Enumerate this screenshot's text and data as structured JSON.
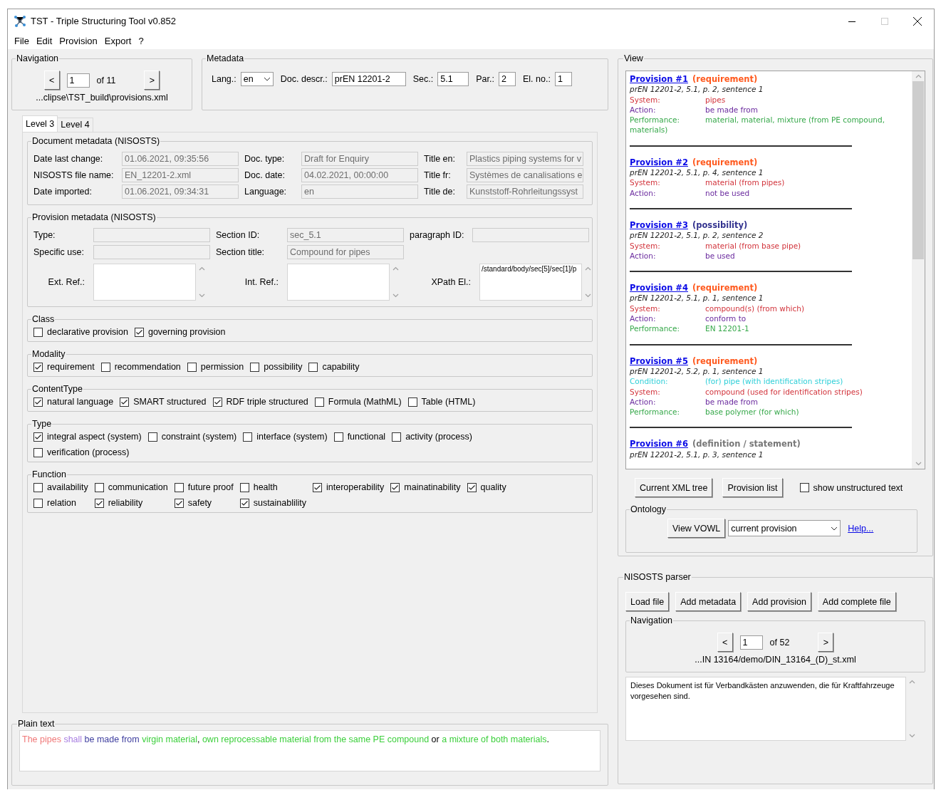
{
  "window": {
    "title": "TST - Triple Structuring Tool v0.852"
  },
  "menu": [
    "File",
    "Edit",
    "Provision",
    "Export",
    "?"
  ],
  "navigation": {
    "title": "Navigation",
    "prev": "<",
    "page": "1",
    "of": "of 11",
    "next": ">",
    "path": "...clipse\\TST_build\\provisions.xml"
  },
  "metadata": {
    "title": "Metadata",
    "fields": [
      {
        "label": "Lang.:",
        "value": "en",
        "kind": "select"
      },
      {
        "label": "Doc. descr.:",
        "value": "prEN 12201-2",
        "kind": "text"
      },
      {
        "label": "Sec.:",
        "value": "5.1",
        "kind": "text"
      },
      {
        "label": "Par.:",
        "value": "2",
        "kind": "short"
      },
      {
        "label": "El. no.:",
        "value": "1",
        "kind": "short"
      }
    ]
  },
  "tabs": [
    {
      "label": "Level 3",
      "selected": true
    },
    {
      "label": "Level 4",
      "selected": false
    }
  ],
  "document_metadata": {
    "title": "Document metadata (NISOSTS)",
    "fields": [
      {
        "label": "Date last change:",
        "value": "01.06.2021, 09:35:56"
      },
      {
        "label": "Doc. type:",
        "value": "Draft for Enquiry"
      },
      {
        "label": "Title en:",
        "value": "Plastics piping systems for v"
      },
      {
        "label": "NISOSTS file name:",
        "value": "EN_12201-2.xml"
      },
      {
        "label": "Doc. date:",
        "value": "04.02.2021, 00:00:00"
      },
      {
        "label": "Title fr:",
        "value": "Systèmes de canalisations e"
      },
      {
        "label": "Date imported:",
        "value": "01.06.2021, 09:34:31"
      },
      {
        "label": "Language:",
        "value": "en"
      },
      {
        "label": "Title de:",
        "value": "Kunststoff-Rohrleitungssyst"
      }
    ]
  },
  "provision_metadata": {
    "title": "Provision metadata (NISOSTS)",
    "fields": [
      {
        "label": "Type:"
      },
      {
        "label": "Section ID:",
        "value": "sec_5.1"
      },
      {
        "label": "paragraph ID:"
      },
      {
        "label": "Specific use:"
      },
      {
        "label": "Section title:",
        "value": "Compound for pipes"
      }
    ],
    "text_areas": [
      {
        "label": "Ext. Ref.:"
      },
      {
        "label": "Int. Ref.:"
      },
      {
        "label": "XPath El.:",
        "value": "/standard/body/sec[5]/sec[1]/p"
      }
    ]
  },
  "checkbox_groups": [
    {
      "title": "Class",
      "rows": [
        [
          {
            "label": "declarative provision",
            "checked": false
          },
          {
            "label": "governing provision",
            "checked": true
          }
        ]
      ]
    },
    {
      "title": "Modality",
      "rows": [
        [
          {
            "label": "requirement",
            "checked": true
          },
          {
            "label": "recommendation",
            "checked": false
          },
          {
            "label": "permission",
            "checked": false
          },
          {
            "label": "possibility",
            "checked": false
          },
          {
            "label": "capability",
            "checked": false
          }
        ]
      ]
    },
    {
      "title": "ContentType",
      "rows": [
        [
          {
            "label": "natural language",
            "checked": true
          },
          {
            "label": "SMART structured",
            "checked": true
          },
          {
            "label": "RDF triple structured",
            "checked": true
          },
          {
            "label": "Formula (MathML)",
            "checked": false
          },
          {
            "label": "Table (HTML)",
            "checked": false
          }
        ]
      ]
    },
    {
      "title": "Type",
      "rows": [
        [
          {
            "label": "integral aspect (system)",
            "checked": true
          },
          {
            "label": "constraint (system)",
            "checked": false
          },
          {
            "label": "interface (system)",
            "checked": false
          },
          {
            "label": "functional",
            "checked": false
          },
          {
            "label": "activity (process)",
            "checked": false
          }
        ],
        [
          {
            "label": "verification (process)",
            "checked": false
          }
        ]
      ]
    },
    {
      "title": "Function",
      "rows": [
        [
          {
            "label": "availability",
            "checked": false
          },
          {
            "label": "communication",
            "checked": false
          },
          {
            "label": "future proof",
            "checked": false
          },
          {
            "label": "health",
            "checked": false
          },
          {
            "label": "interoperability",
            "checked": true
          },
          {
            "label": "mainatinability",
            "checked": true
          },
          {
            "label": "quality",
            "checked": true
          }
        ],
        [
          {
            "label": "relation",
            "checked": false
          },
          {
            "label": "reliability",
            "checked": true
          },
          {
            "label": "safety",
            "checked": true
          },
          {
            "label": "sustainablility",
            "checked": true
          }
        ]
      ]
    }
  ],
  "plain_text": {
    "title": "Plain text",
    "segments": [
      {
        "text": "The pipes ",
        "color": "#f07878"
      },
      {
        "text": "shall ",
        "color": "#a77de0"
      },
      {
        "text": "be made from ",
        "color": "#3f3f9f"
      },
      {
        "text": "virgin material",
        "color": "#3ccf3c"
      },
      {
        "text": ", "
      },
      {
        "text": "own reprocessable material from the same PE compound",
        "color": "#3ccf3c"
      },
      {
        "text": " or "
      },
      {
        "text": "a mixture of both materials",
        "color": "#3ccf3c"
      },
      {
        "text": "."
      }
    ]
  },
  "view": {
    "title": "View",
    "provisions": [
      {
        "link": "Provision #1",
        "modality": "(requirement)",
        "color": "#ff5a1f",
        "source": "prEN 12201-2, 5.1, p. 2, sentence 1",
        "roles": [
          {
            "label": "System:",
            "value": "pipes",
            "color": "#d2343c"
          },
          {
            "label": "Action:",
            "value": "be made from",
            "color": "#6a2a9e"
          },
          {
            "label": "Performance:",
            "value": "material, material, mixture (from PE compound, materials)",
            "color": "#36a84a"
          }
        ]
      },
      {
        "link": "Provision #2",
        "modality": "(requirement)",
        "color": "#ff5a1f",
        "source": "prEN 12201-2, 5.1, p. 4, sentence 1",
        "roles": [
          {
            "label": "System:",
            "value": "material (from pipes)",
            "color": "#d2343c"
          },
          {
            "label": "Action:",
            "value": "not be used",
            "color": "#6a2a9e"
          }
        ]
      },
      {
        "link": "Provision #3",
        "modality": "(possibility)",
        "color": "#33338f",
        "source": "prEN 12201-2, 5.1, p. 2, sentence 2",
        "roles": [
          {
            "label": "System:",
            "value": "material (from base pipe)",
            "color": "#d2343c"
          },
          {
            "label": "Action:",
            "value": "be used",
            "color": "#6a2a9e"
          }
        ]
      },
      {
        "link": "Provision #4",
        "modality": "(requirement)",
        "color": "#ff5a1f",
        "source": "prEN 12201-2, 5.1, p. 1, sentence 1",
        "roles": [
          {
            "label": "System:",
            "value": "compound(s) (from which)",
            "color": "#d2343c"
          },
          {
            "label": "Action:",
            "value": "conform to",
            "color": "#6a2a9e"
          },
          {
            "label": "Performance:",
            "value": "EN 12201-1",
            "color": "#36a84a"
          }
        ]
      },
      {
        "link": "Provision #5",
        "modality": "(requirement)",
        "color": "#ff5a1f",
        "source": "prEN 12201-2, 5.2, p. 1, sentence 1",
        "roles": [
          {
            "label": "Condition:",
            "value": "(for) pipe (with identification stripes)",
            "color": "#2fcfd8"
          },
          {
            "label": "System:",
            "value": "compound (used for identification stripes)",
            "color": "#d2343c"
          },
          {
            "label": "Action:",
            "value": "be made from",
            "color": "#6a2a9e"
          },
          {
            "label": "Performance:",
            "value": "base polymer (for which)",
            "color": "#36a84a"
          }
        ]
      },
      {
        "link": "Provision #6",
        "modality": "(definition / statement)",
        "color": "#777777",
        "source": "prEN 12201-2, 5.1, p. 3, sentence 1"
      }
    ],
    "buttons": [
      "Current XML tree",
      "Provision list"
    ],
    "show_unstructured": {
      "label": "show unstructured text",
      "checked": false
    },
    "ontology": {
      "title": "Ontology",
      "button": "View VOWL",
      "select": "current provision",
      "link": "Help..."
    }
  },
  "parser": {
    "title": "NISOSTS parser",
    "buttons": [
      "Load file",
      "Add metadata",
      "Add provision",
      "Add complete file"
    ],
    "navigation": {
      "title": "Navigation",
      "prev": "<",
      "page": "1",
      "of": "of 52",
      "next": ">",
      "path": "...IN 13164/demo/DIN_13164_(D)_st.xml"
    },
    "text": "Dieses Dokument ist für Verbandkästen anzuwenden, die für Kraftfahrzeuge vorgesehen sind."
  }
}
